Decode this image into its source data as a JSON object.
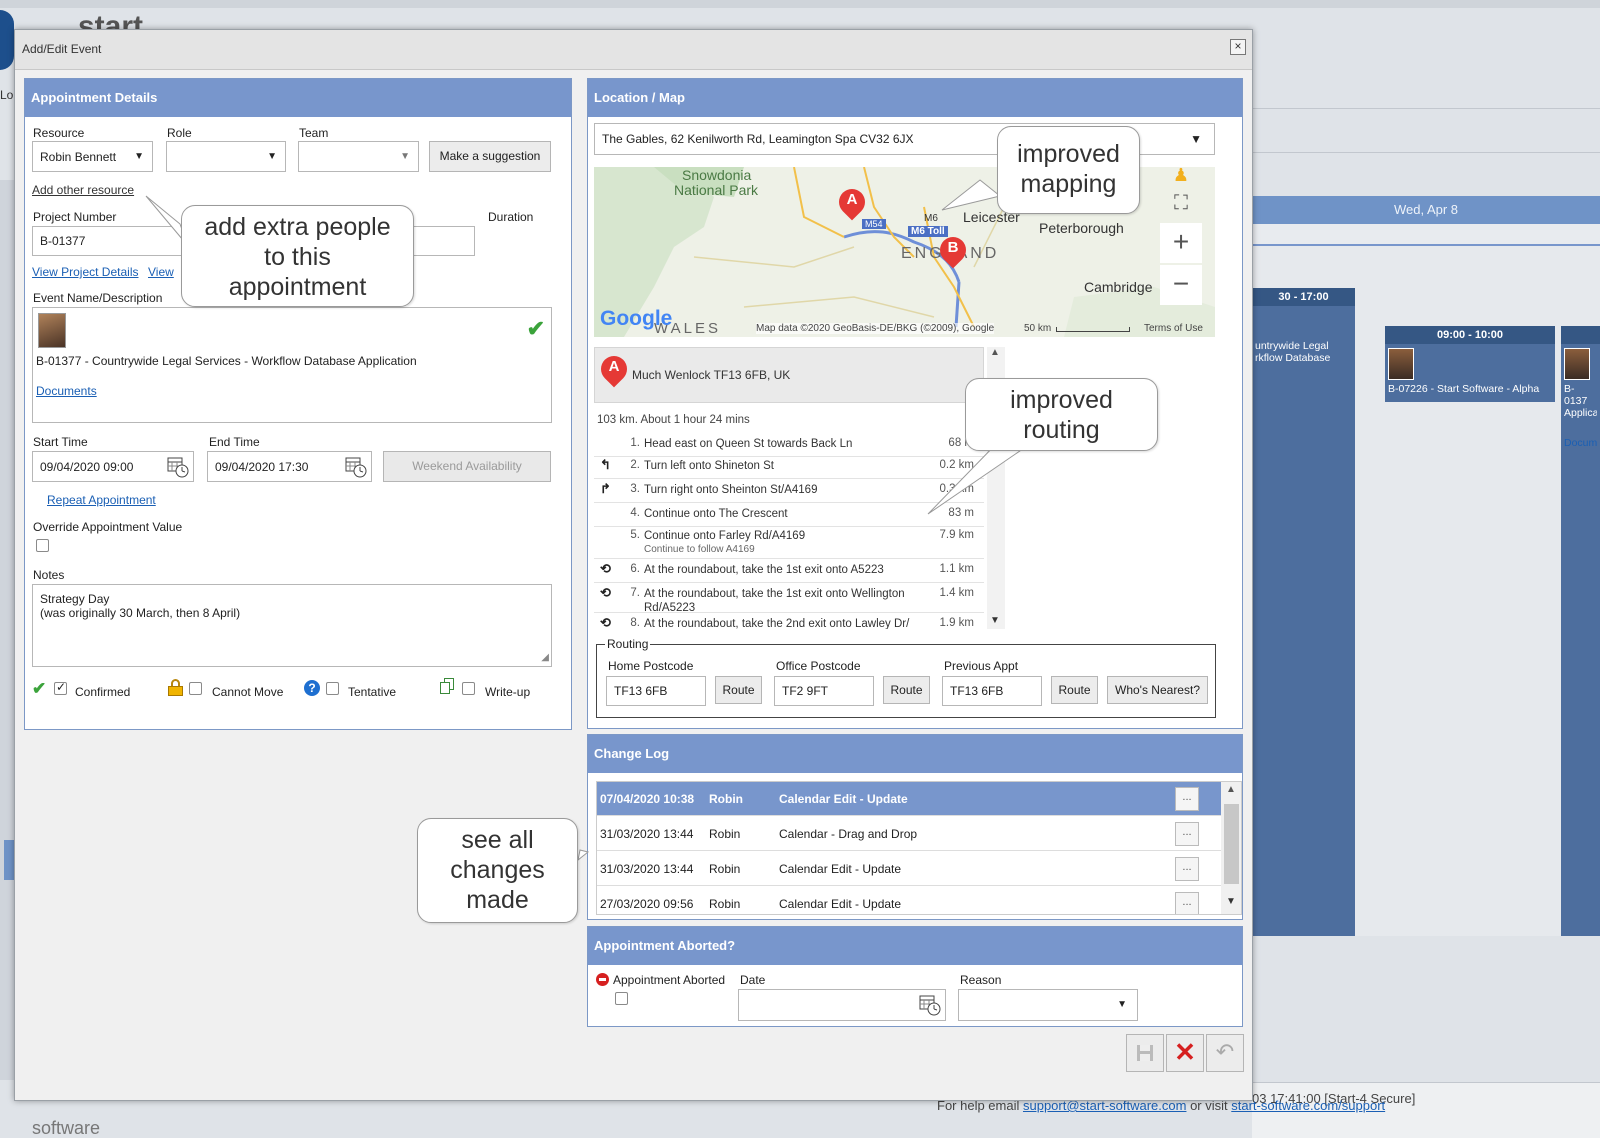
{
  "background": {
    "brand_word": "start",
    "brand_word_footer": "software",
    "left_tab": "Lo",
    "day_header": "Wed, Apr 8",
    "events": [
      {
        "time": "30 - 17:00",
        "text": "untrywide Legal\nrkflow Database"
      },
      {
        "time": "09:00 - 10:00",
        "text": "B-07226 - Start Software - Alpha"
      },
      {
        "time": "",
        "text": "B-0137\nApplica",
        "link": "Docum"
      }
    ],
    "footer_status": "03 17:41:00 [Start-4 Secure]",
    "help": {
      "prefix": "For help email ",
      "email": "support@start-software.com",
      "middle": " or visit ",
      "url": "start-software.com/support"
    }
  },
  "dialog": {
    "title": "Add/Edit Event",
    "close_glyph": "×"
  },
  "appointment": {
    "header": "Appointment Details",
    "resource_label": "Resource",
    "resource_value": "Robin Bennett",
    "role_label": "Role",
    "role_value": "",
    "team_label": "Team",
    "team_value": "",
    "suggest_button": "Make a suggestion",
    "add_resource_link": "Add other resource",
    "project_number_label": "Project Number",
    "project_number_value": "B-01377",
    "duration_label": "Duration",
    "view_project_link": "View Project Details",
    "view_link": "View",
    "event_name_label": "Event Name/Description",
    "event_description": "B-01377 - Countrywide Legal Services - Workflow Database Application",
    "documents_link": "Documents",
    "start_time_label": "Start Time",
    "start_time_value": "09/04/2020 09:00",
    "end_time_label": "End Time",
    "end_time_value": "09/04/2020 17:30",
    "weekend_button": "Weekend Availability",
    "repeat_link": "Repeat Appointment",
    "override_label": "Override Appointment Value",
    "notes_label": "Notes",
    "notes_line1": "Strategy Day",
    "notes_line2": "(was originally 30 March, then 8 April)",
    "confirmed_label": "Confirmed",
    "cannot_move_label": "Cannot Move",
    "tentative_label": "Tentative",
    "writeup_label": "Write-up"
  },
  "location": {
    "header": "Location / Map",
    "address": "The Gables, 62 Kenilworth Rd, Leamington Spa CV32 6JX",
    "map_labels": {
      "snowdonia_1": "Snowdonia",
      "snowdonia_2": "National Park",
      "leicester": "Leicester",
      "peterborough": "Peterborough",
      "england": "ENGLAND",
      "cambridge": "Cambridge",
      "wales": "WALES",
      "m6toll": "M6 Toll",
      "m54": "M54",
      "m6": "M6",
      "google": "Google",
      "attribution": "Map data ©2020 GeoBasis-DE/BKG (©2009), Google",
      "scale": "50 km",
      "terms": "Terms of Use",
      "marker_a": "A",
      "marker_b": "B",
      "zoom_in": "+",
      "zoom_out": "−"
    },
    "start_point_marker": "A",
    "start_point": "Much Wenlock TF13 6FB, UK",
    "summary": "103 km. About 1 hour 24 mins",
    "steps": [
      {
        "n": "1.",
        "icon": "",
        "text": "Head east on Queen St towards Back Ln",
        "sub": "",
        "dist": "68 m"
      },
      {
        "n": "2.",
        "icon": "↰",
        "text": "Turn left onto Shineton St",
        "sub": "",
        "dist": "0.2 km"
      },
      {
        "n": "3.",
        "icon": "↱",
        "text": "Turn right onto Sheinton St/A4169",
        "sub": "",
        "dist": "0.3 km"
      },
      {
        "n": "4.",
        "icon": "",
        "text": "Continue onto The Crescent",
        "sub": "",
        "dist": "83 m"
      },
      {
        "n": "5.",
        "icon": "",
        "text": "Continue onto Farley Rd/A4169",
        "sub": "Continue to follow A4169",
        "dist": "7.9 km"
      },
      {
        "n": "6.",
        "icon": "⟲",
        "text": "At the roundabout, take the 1st exit onto A5223",
        "sub": "",
        "dist": "1.1 km"
      },
      {
        "n": "7.",
        "icon": "⟲",
        "text": "At the roundabout, take the 1st exit onto Wellington Rd/A5223",
        "sub": "",
        "dist": "1.4 km"
      },
      {
        "n": "8.",
        "icon": "⟲",
        "text": "At the roundabout, take the 2nd exit onto Lawley Dr/",
        "sub": "",
        "dist": "1.9 km"
      }
    ],
    "routing": {
      "legend": "Routing",
      "home_label": "Home Postcode",
      "home_value": "TF13 6FB",
      "office_label": "Office Postcode",
      "office_value": "TF2 9FT",
      "previous_label": "Previous Appt",
      "previous_value": "TF13 6FB",
      "route_button": "Route",
      "nearest_button": "Who's Nearest?"
    }
  },
  "change_log": {
    "header": "Change Log",
    "more_glyph": "...",
    "rows": [
      {
        "date": "07/04/2020 10:38",
        "user": "Robin",
        "action": "Calendar Edit - Update"
      },
      {
        "date": "31/03/2020 13:44",
        "user": "Robin",
        "action": "Calendar - Drag and Drop"
      },
      {
        "date": "31/03/2020 13:44",
        "user": "Robin",
        "action": "Calendar Edit - Update"
      },
      {
        "date": "27/03/2020 09:56",
        "user": "Robin",
        "action": "Calendar Edit - Update"
      }
    ]
  },
  "aborted": {
    "header": "Appointment Aborted?",
    "aborted_label": "Appointment Aborted",
    "date_label": "Date",
    "date_value": "",
    "reason_label": "Reason",
    "reason_value": ""
  },
  "callouts": {
    "add_people": "add extra people\nto this\nappointment",
    "mapping": "improved\nmapping",
    "routing": "improved\nrouting",
    "changes": "see all\nchanges\nmade"
  },
  "colors": {
    "panel_header": "#7896cc",
    "calendar_event": "#4d6e9e",
    "selected_row": "#7896cc",
    "cancel_red": "#d62020",
    "confirm_green": "#3ba33b",
    "marker_red": "#e53935"
  }
}
